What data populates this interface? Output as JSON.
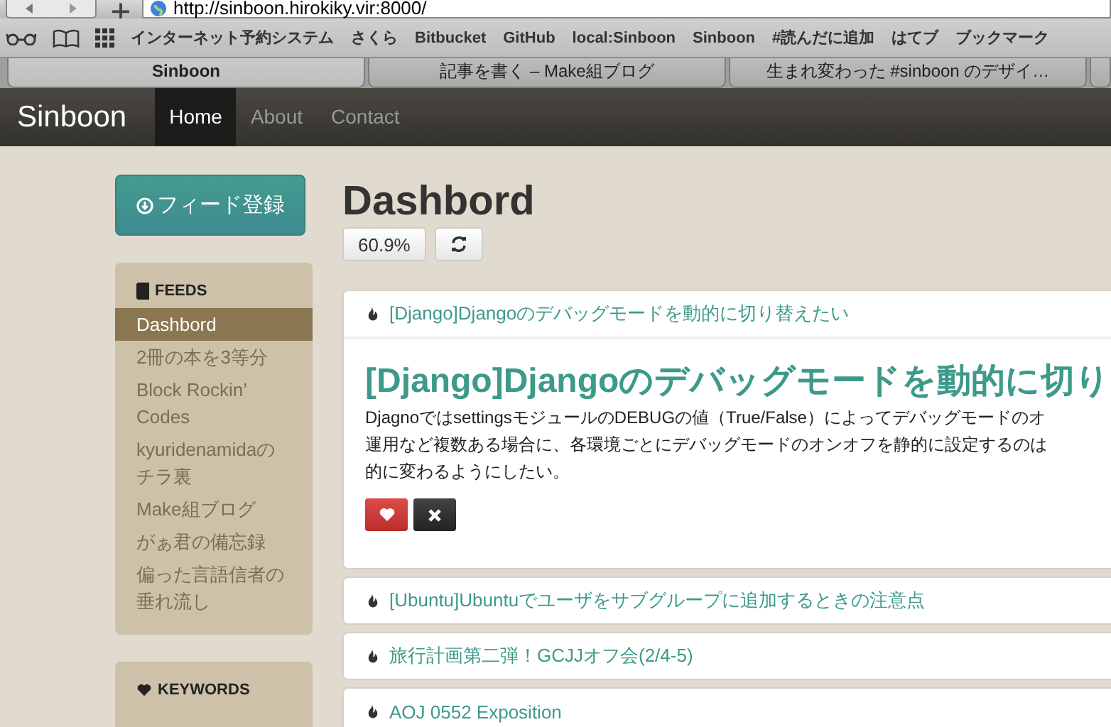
{
  "browser": {
    "url": "http://sinboon.hirokiky.vir:8000/",
    "bookmarks": [
      "インターネット予約システム",
      "さくら",
      "Bitbucket",
      "GitHub",
      "local:Sinboon",
      "Sinboon",
      "#読んだに追加",
      "はてブ",
      "ブックマーク"
    ],
    "tabs": [
      {
        "label": "Sinboon",
        "selected": true
      },
      {
        "label": "記事を書く – Make組ブログ",
        "selected": false
      },
      {
        "label": "生まれ変わった #sinboon のデザイ…",
        "selected": false
      },
      {
        "selected": false
      }
    ]
  },
  "navbar": {
    "brand": "Sinboon",
    "items": [
      {
        "label": "Home",
        "selected": true
      },
      {
        "label": "About",
        "selected": false
      },
      {
        "label": "Contact",
        "selected": false
      }
    ]
  },
  "sidebar": {
    "add_button": "フィード登録",
    "feeds": {
      "heading": "FEEDS",
      "items": [
        {
          "label": "Dashbord",
          "selected": true
        },
        {
          "label": "2冊の本を3等分",
          "selected": false
        },
        {
          "label": "Block Rockin’ Codes",
          "selected": false
        },
        {
          "label": "kyuridenamidaのチラ裏",
          "selected": false
        },
        {
          "label": "Make組ブログ",
          "selected": false
        },
        {
          "label": "がぁ君の備忘録",
          "selected": false
        },
        {
          "label": "偏った言語信者の垂れ流し",
          "selected": false
        }
      ]
    },
    "keywords": {
      "heading": "KEYWORDS"
    }
  },
  "main": {
    "title": "Dashbord",
    "progress": "60.9%",
    "articles": [
      {
        "title": "[Django]Djangoのデバッグモードを動的に切り替えたい",
        "expanded": true,
        "headline": "[Django]Djangoのデバッグモードを動的に切り",
        "body": [
          "DjagnoではsettingsモジュールのDEBUGの値（True/False）によってデバッグモードのオ",
          "運用など複数ある場合に、各環境ごとにデバッグモードのオンオフを静的に設定するのは",
          "的に変わるようにしたい。"
        ]
      },
      {
        "title": "[Ubuntu]Ubuntuでユーザをサブグループに追加するときの注意点",
        "expanded": false
      },
      {
        "title": "旅行計画第二弾！GCJJオフ会(2/4-5)",
        "expanded": false
      },
      {
        "title": "AOJ 0552 Exposition",
        "expanded": false
      }
    ]
  }
}
